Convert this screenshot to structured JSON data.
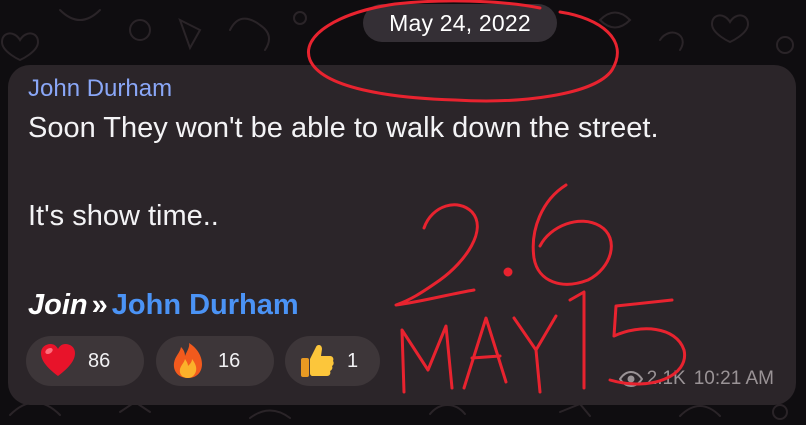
{
  "date_separator": "May 24, 2022",
  "message": {
    "sender": "John Durham",
    "lines": [
      "Soon They won't be able to walk down the street.",
      "It's show time.."
    ],
    "join": {
      "word": "Join",
      "separator": "»",
      "channel": "John Durham"
    },
    "reactions": [
      {
        "icon": "heart-icon",
        "count": "86"
      },
      {
        "icon": "fire-icon",
        "count": "16"
      },
      {
        "icon": "thumbs-up-icon",
        "count": "1"
      }
    ],
    "views": "2.1K",
    "time": "10:21 AM"
  },
  "annotation": {
    "color": "#e8232f",
    "text_lines": [
      "2.6",
      "MAY 15"
    ]
  },
  "colors": {
    "bubble": "#2b2529",
    "sender_name": "#8aa7f7",
    "link": "#4b93f5"
  }
}
